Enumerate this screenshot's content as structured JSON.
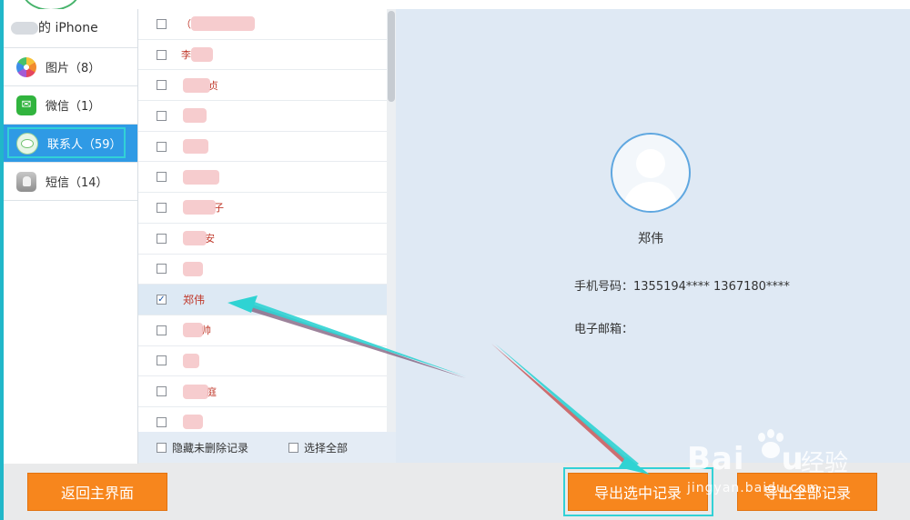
{
  "device": {
    "name_suffix": "的 iPhone"
  },
  "sidebar": {
    "items": [
      {
        "label": "图片（8）",
        "icon": "photos-icon"
      },
      {
        "label": "微信（1）",
        "icon": "wechat-icon"
      },
      {
        "label": "联系人（59）",
        "icon": "contacts-icon",
        "active": true
      },
      {
        "label": "短信（14）",
        "icon": "sms-icon"
      }
    ]
  },
  "contacts": {
    "rows": [
      {
        "prefix": "（",
        "suffix": "",
        "blur_width": 70,
        "checked": false
      },
      {
        "prefix": "李",
        "suffix": "",
        "blur_width": 24,
        "checked": false
      },
      {
        "prefix": "",
        "suffix": "贞",
        "blur_width": 30,
        "checked": false
      },
      {
        "prefix": "",
        "suffix": "",
        "blur_width": 26,
        "checked": false
      },
      {
        "prefix": "",
        "suffix": "",
        "blur_width": 28,
        "checked": false
      },
      {
        "prefix": "",
        "suffix": "",
        "blur_width": 40,
        "checked": false
      },
      {
        "prefix": "",
        "suffix": "子",
        "blur_width": 36,
        "checked": false
      },
      {
        "prefix": "",
        "suffix": "安",
        "blur_width": 26,
        "checked": false
      },
      {
        "prefix": "",
        "suffix": "",
        "blur_width": 22,
        "checked": false
      },
      {
        "name": "郑伟",
        "checked": true,
        "selected": true
      },
      {
        "prefix": "",
        "suffix": "帅",
        "blur_width": 22,
        "checked": false
      },
      {
        "prefix": "",
        "suffix": "",
        "blur_width": 18,
        "checked": false
      },
      {
        "prefix": "",
        "suffix": "庭",
        "blur_width": 28,
        "checked": false
      },
      {
        "prefix": "",
        "suffix": "",
        "blur_width": 22,
        "checked": false
      }
    ],
    "footer": {
      "hide_deleted_label": "隐藏未删除记录",
      "select_all_label": "选择全部"
    }
  },
  "detail": {
    "name": "郑伟",
    "phone": "手机号码：1355194**** 1367180****",
    "email": "电子邮箱："
  },
  "buttons": {
    "back": "返回主界面",
    "export_selected": "导出选中记录",
    "export_all": "导出全部记录"
  },
  "watermark": {
    "logo": "Bai",
    "logo_tail": "u",
    "cn": "经验",
    "url": "jingyan.baidu.com"
  },
  "colors": {
    "accent_orange": "#f7861d",
    "active_blue": "#2f9ae5",
    "highlight_cyan": "#32d1d6",
    "name_red": "#c0392b"
  }
}
